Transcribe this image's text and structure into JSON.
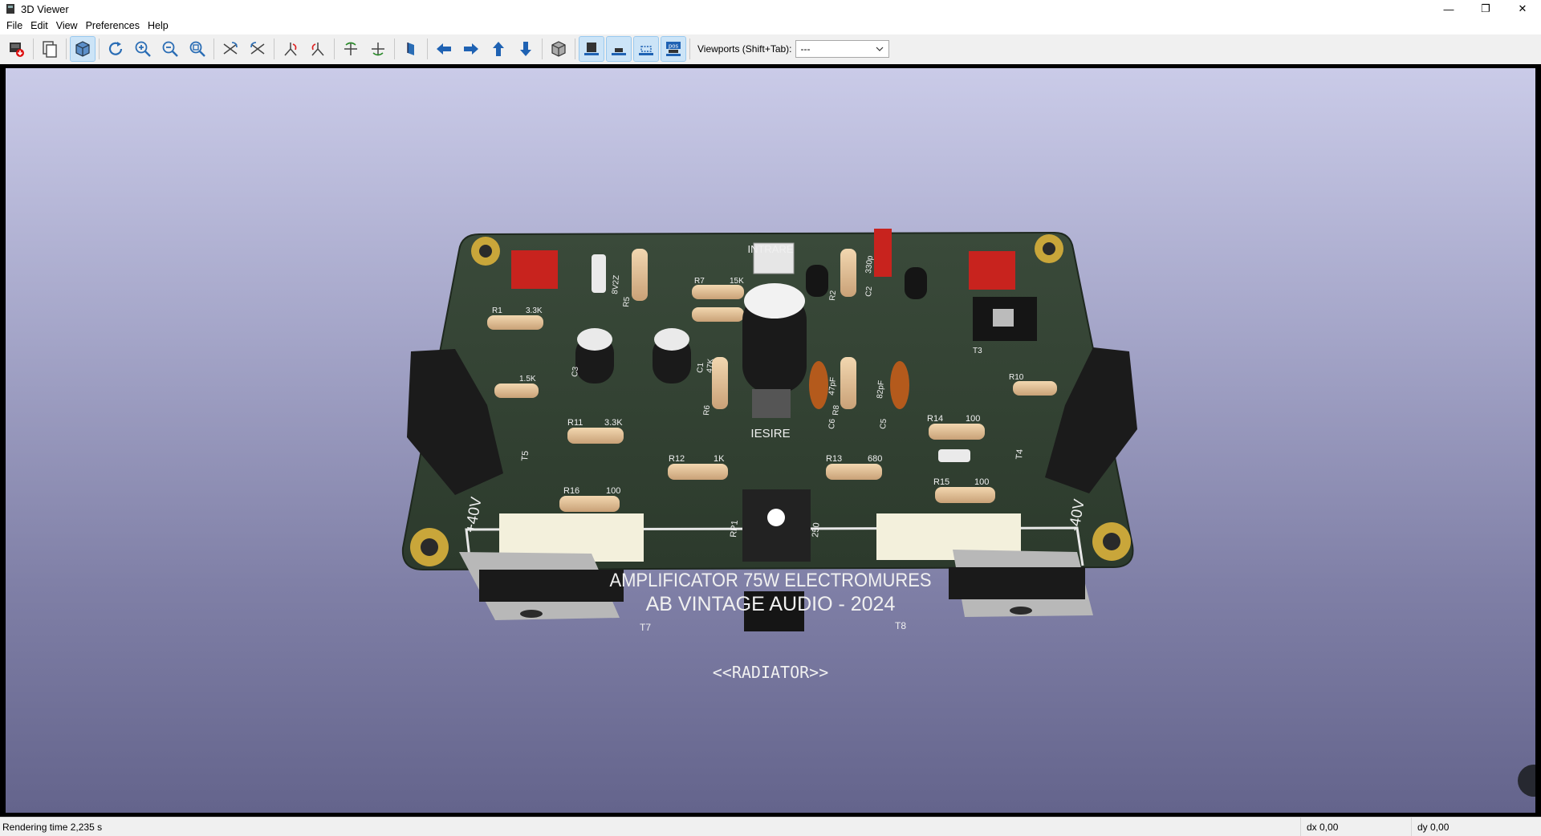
{
  "window": {
    "title": "3D Viewer",
    "minimize": "—",
    "maximize": "❐",
    "close": "✕"
  },
  "menu": [
    "File",
    "Edit",
    "View",
    "Preferences",
    "Help"
  ],
  "toolbar": {
    "viewports_label": "Viewports (Shift+Tab):",
    "viewports_value": "---",
    "layer_toggle_label": "pos"
  },
  "board": {
    "title_line1": "AMPLIFICATOR 75W ELECTROMURES",
    "title_line2": "AB VINTAGE AUDIO - 2024",
    "radiator": "<<RADIATOR>>",
    "labels": {
      "iesire": "IESIRE",
      "intrare": "INTRARE",
      "plus40": "+40V",
      "minus40": "-40V",
      "t7": "T7",
      "t8": "T8",
      "t5": "T5",
      "t4": "T4",
      "rp1": "RP1",
      "v250": "250",
      "r11": "R11",
      "v33k": "3.3K",
      "r12": "R12",
      "v1k": "1K",
      "r13": "R13",
      "v680": "680",
      "r14": "R14",
      "v100a": "100",
      "r15": "R15",
      "v100b": "100",
      "r16": "R16",
      "v100c": "100",
      "r6": "R6",
      "r8": "R8",
      "c1": "C1",
      "v47k": "47K",
      "c3": "C3",
      "c5": "C5",
      "c6": "C6",
      "v47pf": "47pF",
      "v82pf": "82pF",
      "r2": "R2",
      "c2": "C2",
      "v330p": "330p",
      "r5": "R5",
      "r7": "R7",
      "v15k": "15K",
      "v8v2z": "8V2Z",
      "v15ka": "1.5K",
      "r10": "R10",
      "r1": "R1",
      "v33ka": "3.3K",
      "t3": "T3"
    }
  },
  "status": {
    "message": "Rendering time 2,235 s",
    "dx": "dx 0,00",
    "dy": "dy 0,00"
  }
}
